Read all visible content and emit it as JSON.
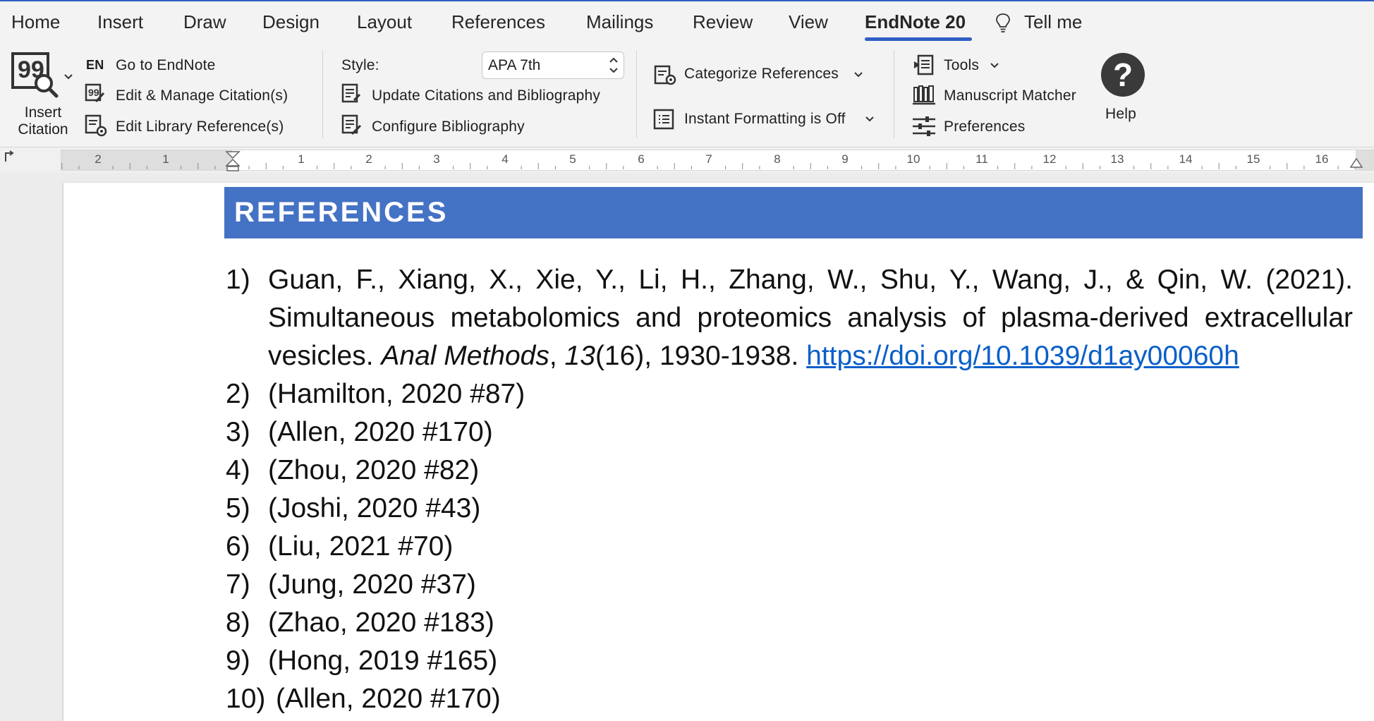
{
  "tabs": [
    {
      "label": "Home"
    },
    {
      "label": "Insert"
    },
    {
      "label": "Draw"
    },
    {
      "label": "Design"
    },
    {
      "label": "Layout"
    },
    {
      "label": "References"
    },
    {
      "label": "Mailings"
    },
    {
      "label": "Review"
    },
    {
      "label": "View"
    },
    {
      "label": "EndNote 20",
      "active": true
    },
    {
      "label": "Tell me"
    }
  ],
  "ribbon": {
    "insert_citation": {
      "label_line1": "Insert",
      "label_line2": "Citation"
    },
    "go_to_endnote": {
      "badge": "EN",
      "label": "Go to EndNote"
    },
    "edit_manage": "Edit & Manage Citation(s)",
    "edit_library": "Edit Library Reference(s)",
    "style_label": "Style:",
    "style_value": "APA 7th",
    "update_citations": "Update Citations and Bibliography",
    "configure_bibliography": "Configure Bibliography",
    "categorize": "Categorize References",
    "instant_formatting": "Instant Formatting is Off",
    "tools": "Tools",
    "manuscript_matcher": "Manuscript Matcher",
    "preferences": "Preferences",
    "help": "Help"
  },
  "ruler": {
    "left_numbers": [
      "2",
      "1"
    ],
    "numbers": [
      "1",
      "2",
      "3",
      "4",
      "5",
      "6",
      "7",
      "8",
      "9",
      "10",
      "11",
      "12",
      "13",
      "14",
      "15",
      "16"
    ]
  },
  "document": {
    "heading": "REFERENCES",
    "ref1": {
      "num": "1)",
      "authors": "Guan, F., Xiang, X., Xie, Y., Li, H., Zhang, W., Shu, Y., Wang, J., & Qin, W. (2021). Simultaneous metabolomics and proteomics analysis of plasma-derived extracellular vesicles. ",
      "journal": "Anal Methods",
      "sep1": ", ",
      "volume": "13",
      "issue_pages": "(16), 1930-1938. ",
      "doi": "https://doi.org/10.1039/d1ay00060h"
    },
    "references": [
      {
        "num": "2)",
        "text": "(Hamilton, 2020 #87)"
      },
      {
        "num": "3)",
        "text": "(Allen, 2020 #170)"
      },
      {
        "num": "4)",
        "text": "(Zhou, 2020 #82)"
      },
      {
        "num": "5)",
        "text": "(Joshi, 2020 #43)"
      },
      {
        "num": "6)",
        "text": "(Liu, 2021 #70)"
      },
      {
        "num": "7)",
        "text": "(Jung, 2020 #37)"
      },
      {
        "num": "8)",
        "text": "(Zhao, 2020 #183)"
      },
      {
        "num": "9)",
        "text": "(Hong, 2019 #165)"
      },
      {
        "num": "10)",
        "text": "(Allen, 2020 #170)"
      }
    ]
  },
  "colors": {
    "accent": "#2f5ec4",
    "heading_bg": "#4472c4",
    "link": "#0a5fc9"
  }
}
